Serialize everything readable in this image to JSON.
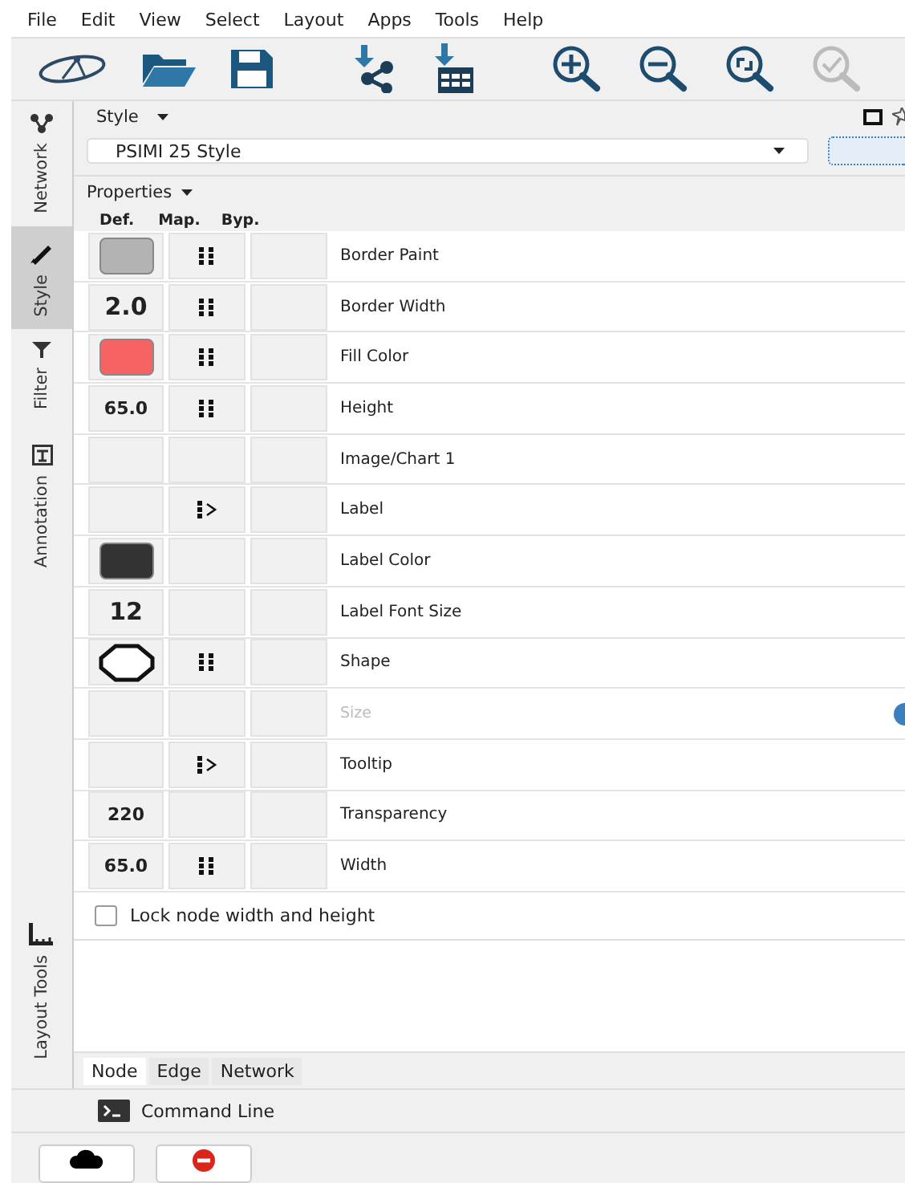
{
  "menu": [
    "File",
    "Edit",
    "View",
    "Select",
    "Layout",
    "Apps",
    "Tools",
    "Help"
  ],
  "toolbar": [
    {
      "kind": "logo",
      "disabled": false
    },
    {
      "kind": "open",
      "disabled": false
    },
    {
      "kind": "save",
      "disabled": false
    },
    {
      "kind": "import_network",
      "disabled": false
    },
    {
      "kind": "import_table",
      "disabled": false
    },
    {
      "kind": "zoom_in",
      "disabled": false
    },
    {
      "kind": "zoom_out",
      "disabled": false
    },
    {
      "kind": "zoom_fit",
      "disabled": false
    },
    {
      "kind": "check",
      "disabled": true
    }
  ],
  "side_tabs": [
    {
      "label": "Network",
      "kind": "network",
      "selected": false
    },
    {
      "label": "Style",
      "kind": "style",
      "selected": true
    },
    {
      "label": "Filter",
      "kind": "filter",
      "selected": false
    },
    {
      "label": "Annotation",
      "kind": "annotation",
      "selected": false
    },
    {
      "label": "Layout Tools",
      "kind": "layout",
      "selected": false
    }
  ],
  "style_panel": {
    "title": "Style",
    "dropdown": {
      "value": "PSIMI 25 Style"
    }
  },
  "properties": {
    "title": "Properties",
    "columns": [
      "Def.",
      "Map.",
      "Byp."
    ],
    "rows": [
      {
        "name": "Border Paint",
        "default": {
          "kind": "color",
          "color": "#b3b3b3"
        },
        "mapping": {
          "kind": "discrete"
        },
        "disabled": false,
        "info": false
      },
      {
        "name": "Border Width",
        "default": {
          "kind": "value",
          "text": "2.0"
        },
        "mapping": {
          "kind": "discrete"
        },
        "disabled": false,
        "info": false
      },
      {
        "name": "Fill Color",
        "default": {
          "kind": "color",
          "color": "#f76363"
        },
        "mapping": {
          "kind": "discrete"
        },
        "disabled": false,
        "info": false
      },
      {
        "name": "Height",
        "default": {
          "kind": "value",
          "text": "65.0"
        },
        "mapping": {
          "kind": "discrete"
        },
        "disabled": false,
        "info": false
      },
      {
        "name": "Image/Chart 1",
        "default": {
          "kind": "none"
        },
        "disabled": false,
        "info": false
      },
      {
        "name": "Label",
        "default": {
          "kind": "none"
        },
        "mapping": {
          "kind": "passthrough"
        },
        "disabled": false,
        "info": false
      },
      {
        "name": "Label Color",
        "default": {
          "kind": "color",
          "color": "#333333"
        },
        "disabled": false,
        "info": false
      },
      {
        "name": "Label Font Size",
        "default": {
          "kind": "value",
          "text": "12"
        },
        "disabled": false,
        "info": false
      },
      {
        "name": "Shape",
        "default": {
          "kind": "shape"
        },
        "mapping": {
          "kind": "discrete"
        },
        "disabled": false,
        "info": false
      },
      {
        "name": "Size",
        "default": {
          "kind": "none"
        },
        "disabled": true,
        "info": true
      },
      {
        "name": "Tooltip",
        "default": {
          "kind": "none"
        },
        "mapping": {
          "kind": "passthrough"
        },
        "disabled": false,
        "info": false
      },
      {
        "name": "Transparency",
        "default": {
          "kind": "value",
          "text": "220"
        },
        "disabled": false,
        "info": false
      },
      {
        "name": "Width",
        "default": {
          "kind": "value",
          "text": "65.0"
        },
        "mapping": {
          "kind": "discrete"
        },
        "disabled": false,
        "info": false
      }
    ]
  },
  "lock": {
    "label": "Lock node width and height",
    "checked": false
  },
  "bottom_tabs": [
    {
      "label": "Node",
      "selected": true
    },
    {
      "label": "Edge",
      "selected": false
    },
    {
      "label": "Network",
      "selected": false
    }
  ],
  "command_line": {
    "label": "Command Line"
  },
  "bottom_buttons": [
    {
      "kind": "cloud"
    },
    {
      "kind": "stop"
    }
  ]
}
